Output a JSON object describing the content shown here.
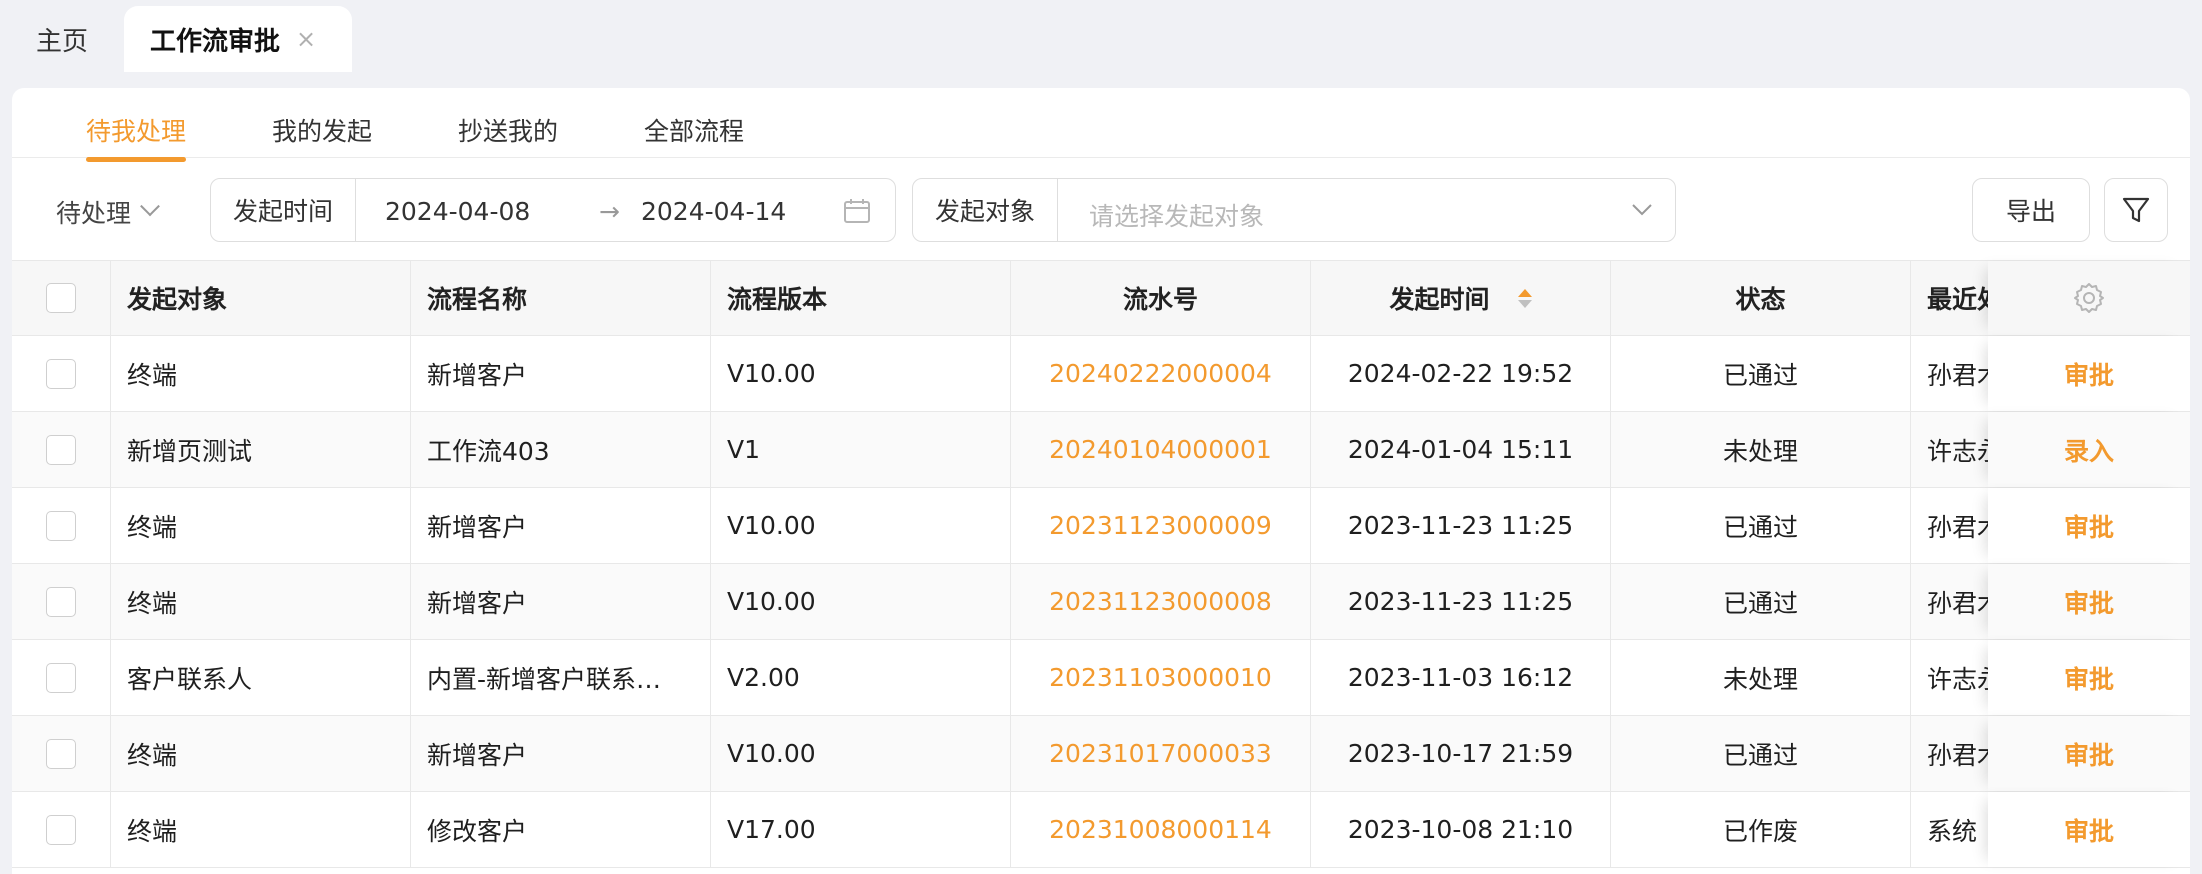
{
  "tabs": {
    "home": "主页",
    "active": "工作流审批",
    "close": "×"
  },
  "subtabs": [
    "待我处理",
    "我的发起",
    "抄送我的",
    "全部流程"
  ],
  "filters": {
    "status": "待处理",
    "time_label": "发起时间",
    "date_start": "2024-04-08",
    "date_sep": "→",
    "date_end": "2024-04-14",
    "target_label": "发起对象",
    "target_placeholder": "请选择发起对象",
    "export_label": "导出"
  },
  "table": {
    "headers": [
      "发起对象",
      "流程名称",
      "流程版本",
      "流水号",
      "发起时间",
      "状态",
      "最近处"
    ],
    "rows": [
      {
        "target": "终端",
        "name": "新增客户",
        "version": "V10.00",
        "serial": "20240222000004",
        "time": "2024-02-22 19:52",
        "status": "已通过",
        "handler": "孙君木",
        "action": "审批"
      },
      {
        "target": "新增页测试",
        "name": "工作流403",
        "version": "V1",
        "serial": "20240104000001",
        "time": "2024-01-04 15:11",
        "status": "未处理",
        "handler": "许志永",
        "action": "录入"
      },
      {
        "target": "终端",
        "name": "新增客户",
        "version": "V10.00",
        "serial": "20231123000009",
        "time": "2023-11-23 11:25",
        "status": "已通过",
        "handler": "孙君木",
        "action": "审批"
      },
      {
        "target": "终端",
        "name": "新增客户",
        "version": "V10.00",
        "serial": "20231123000008",
        "time": "2023-11-23 11:25",
        "status": "已通过",
        "handler": "孙君木",
        "action": "审批"
      },
      {
        "target": "客户联系人",
        "name": "内置-新增客户联系…",
        "version": "V2.00",
        "serial": "20231103000010",
        "time": "2023-11-03 16:12",
        "status": "未处理",
        "handler": "许志永",
        "action": "审批"
      },
      {
        "target": "终端",
        "name": "新增客户",
        "version": "V10.00",
        "serial": "20231017000033",
        "time": "2023-10-17 21:59",
        "status": "已通过",
        "handler": "孙君木",
        "action": "审批"
      },
      {
        "target": "终端",
        "name": "修改客户",
        "version": "V17.00",
        "serial": "20231008000114",
        "time": "2023-10-08 21:10",
        "status": "已作废",
        "handler": "系统",
        "action": "审批"
      }
    ]
  },
  "colors": {
    "accent": "#f39a2e",
    "background": "#f0f1f5"
  },
  "icons": [
    "close-icon",
    "chevron-down-icon",
    "calendar-icon",
    "arrow-right-icon",
    "filter-icon",
    "gear-icon",
    "sort-icon"
  ]
}
